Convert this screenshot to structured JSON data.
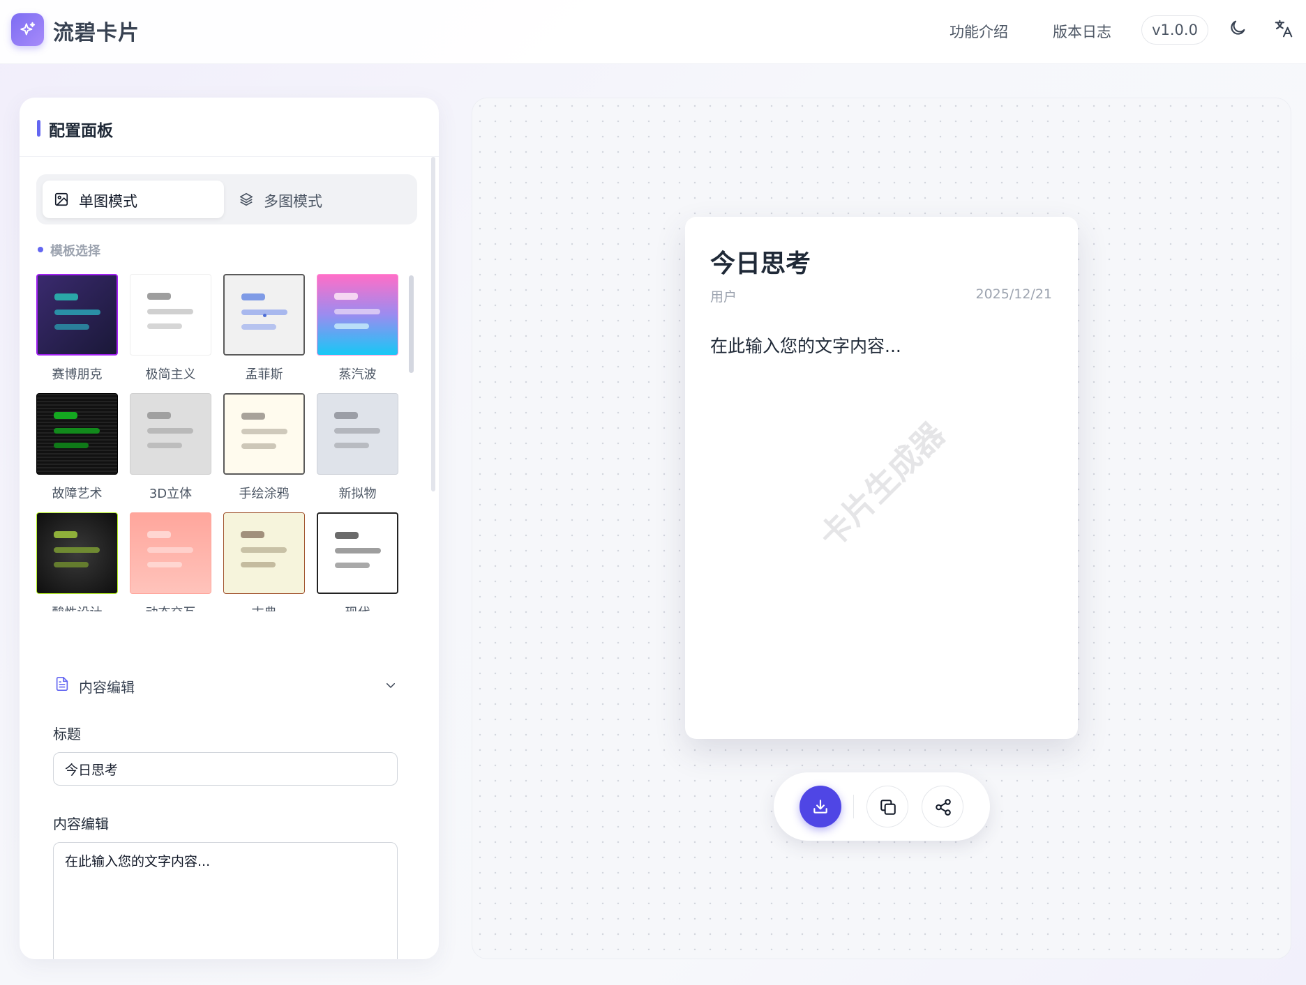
{
  "header": {
    "app_name": "流碧卡片",
    "nav": [
      "功能介绍",
      "版本日志"
    ],
    "version": "v1.0.0",
    "icons": [
      "sparkles-logo-icon",
      "moon-icon",
      "translate-icon"
    ]
  },
  "panel": {
    "title": "配置面板",
    "modes": [
      {
        "label": "单图模式",
        "icon": "image-icon",
        "active": true
      },
      {
        "label": "多图模式",
        "icon": "layers-icon",
        "active": false
      }
    ],
    "template_section": "模板选择",
    "templates": [
      {
        "name": "赛博朋克",
        "bg": "#2a2158",
        "accent": "#2aa7a7",
        "border": "#a020f0"
      },
      {
        "name": "极简主义",
        "bg": "#ffffff",
        "accent": "#b8b8b8",
        "border": "#eeeeee"
      },
      {
        "name": "孟菲斯",
        "bg": "#f1f1f1",
        "accent": "#8fa4e8",
        "border": "#5a5a5a"
      },
      {
        "name": "蒸汽波",
        "bg": "#ff6ec7",
        "accent": "#f2d7f5",
        "border": "#ff8bd4"
      },
      {
        "name": "故障艺术",
        "bg": "#141414",
        "accent": "#14a820",
        "border": "#000000"
      },
      {
        "name": "3D立体",
        "bg": "#dedede",
        "accent": "#a9a9a9",
        "border": "#cfcfcf"
      },
      {
        "name": "手绘涂鸦",
        "bg": "#fffbee",
        "accent": "#c7c1b3",
        "border": "#5a5a5a"
      },
      {
        "name": "新拟物",
        "bg": "#dfe3ea",
        "accent": "#a7aab1",
        "border": "#cdd1d8"
      },
      {
        "name": "酸性设计",
        "bg": "#1d1d1d",
        "accent": "#8fb03a",
        "border": "#b6f027"
      },
      {
        "name": "动态交互",
        "bg": "#ffb0a8",
        "accent": "#ffd6d2",
        "border": "#ffa69c"
      },
      {
        "name": "古典",
        "bg": "#f6f4dc",
        "accent": "#c7bfa8",
        "border": "#a0522d"
      },
      {
        "name": "现代",
        "bg": "#ffffff",
        "accent": "#9e9e9e",
        "border": "#222222"
      }
    ],
    "content_section": "内容编辑",
    "title_label": "标题",
    "title_value": "今日思考",
    "content_label": "内容编辑",
    "content_value": "在此输入您的文字内容..."
  },
  "card": {
    "title": "今日思考",
    "author": "用户",
    "date": "2025/12/21",
    "body": "在此输入您的文字内容...",
    "watermark": "卡片生成器"
  },
  "actions": [
    "download-icon",
    "copy-icon",
    "share-icon"
  ],
  "colors": {
    "accent": "#4f46e5",
    "accent_light": "#6366f1"
  }
}
